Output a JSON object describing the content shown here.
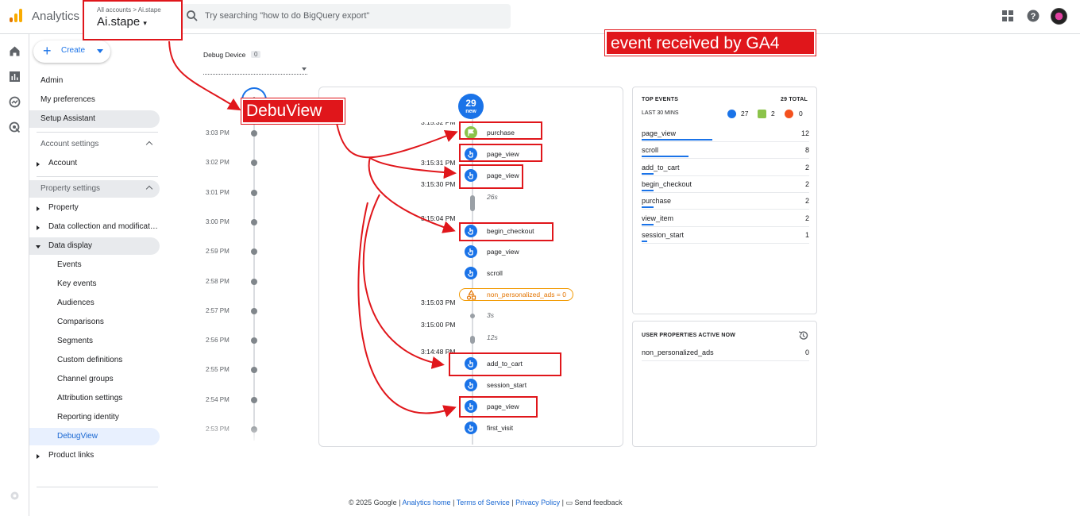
{
  "header": {
    "app_title": "Analytics",
    "account_breadcrumb": "All accounts > Ai.stape",
    "account_name": "Ai.stape",
    "search_placeholder": "Try searching \"how to do BigQuery export\""
  },
  "nav": {
    "create_label": "Create",
    "items": {
      "admin": "Admin",
      "my_preferences": "My preferences",
      "setup_assistant": "Setup Assistant",
      "account_settings": "Account settings",
      "account": "Account",
      "property_settings": "Property settings",
      "property": "Property",
      "data_collection": "Data collection and modifications",
      "data_display": "Data display",
      "events": "Events",
      "key_events": "Key events",
      "audiences": "Audiences",
      "comparisons": "Comparisons",
      "segments": "Segments",
      "custom_definitions": "Custom definitions",
      "channel_groups": "Channel groups",
      "attribution_settings": "Attribution settings",
      "reporting_identity": "Reporting identity",
      "debugview": "DebugView",
      "product_links": "Product links"
    }
  },
  "debug_device": {
    "label": "Debug Device",
    "count": "0"
  },
  "minutes": {
    "counter": "0",
    "labels": [
      "3:03 PM",
      "3:02 PM",
      "3:01 PM",
      "3:00 PM",
      "2:59 PM",
      "2:58 PM",
      "2:57 PM",
      "2:56 PM",
      "2:55 PM",
      "2:54 PM",
      "2:53 PM"
    ]
  },
  "stream": {
    "new_count": "29",
    "new_label": "new",
    "timestamps": [
      "3:15:32 PM",
      "3:15:31 PM",
      "3:15:30 PM",
      "3:15:04 PM",
      "3:15:03 PM",
      "3:15:00 PM",
      "3:14:48 PM"
    ],
    "durations": [
      "26s",
      "3s",
      "12s"
    ],
    "events": [
      "purchase",
      "page_view",
      "page_view",
      "begin_checkout",
      "page_view",
      "scroll",
      "add_to_cart",
      "session_start",
      "page_view",
      "first_visit"
    ],
    "property_change": "non_personalized_ads = 0"
  },
  "top_events": {
    "title": "TOP EVENTS",
    "total": "29 TOTAL",
    "period": "LAST 30 MINS",
    "counts": {
      "events": "27",
      "key_events": "2",
      "errors": "0"
    },
    "rows": [
      {
        "name": "page_view",
        "value": "12",
        "share": 0.42
      },
      {
        "name": "scroll",
        "value": "8",
        "share": 0.28
      },
      {
        "name": "add_to_cart",
        "value": "2",
        "share": 0.07
      },
      {
        "name": "begin_checkout",
        "value": "2",
        "share": 0.07
      },
      {
        "name": "purchase",
        "value": "2",
        "share": 0.07
      },
      {
        "name": "view_item",
        "value": "2",
        "share": 0.07
      },
      {
        "name": "session_start",
        "value": "1",
        "share": 0.035
      }
    ]
  },
  "user_properties": {
    "title": "USER PROPERTIES ACTIVE NOW",
    "rows": [
      {
        "name": "non_personalized_ads",
        "value": "0"
      }
    ]
  },
  "annotations": {
    "received": "event received by GA4",
    "debugview": "DebuView"
  },
  "footer": {
    "copyright": "© 2025 Google",
    "analytics_home": "Analytics home",
    "terms": "Terms of Service",
    "privacy": "Privacy Policy",
    "feedback": "Send feedback"
  },
  "colors": {
    "accent": "#1a73e8",
    "annotation": "#e0161b",
    "key_event": "#8bc34a",
    "warning": "#e37400"
  }
}
